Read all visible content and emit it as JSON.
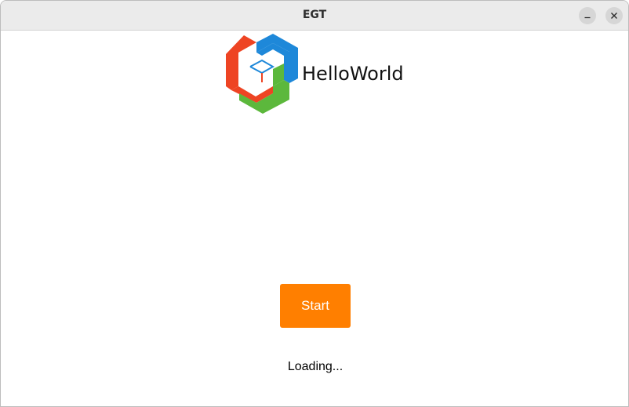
{
  "window": {
    "title": "EGT",
    "controls": {
      "minimize_icon": "minimize-icon",
      "close_icon": "close-icon"
    }
  },
  "header": {
    "logo_icon": "egt-logo-icon",
    "app_name": "HelloWorld"
  },
  "main": {
    "start_label": "Start",
    "status_text": "Loading..."
  },
  "colors": {
    "accent": "#ff7f00",
    "logo_red": "#ee4423",
    "logo_blue": "#1e88d9",
    "logo_green": "#5cb83c",
    "titlebar_bg": "#ebebeb"
  }
}
